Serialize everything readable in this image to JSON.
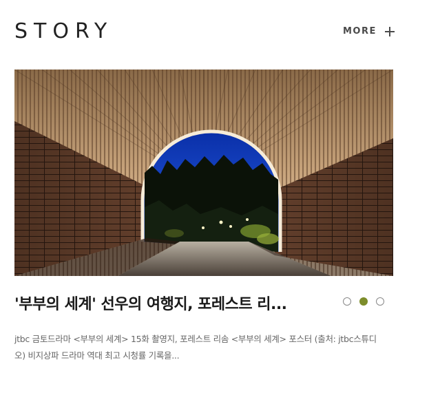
{
  "section": {
    "title": "STORY",
    "more_label": "MORE"
  },
  "hero": {
    "alt": "Forest tunnel with wooden slat arch at night"
  },
  "article": {
    "headline": "'부부의 세계' 선우의 여행지, 포레스트 리...",
    "excerpt": "jtbc 금토드라마 <부부의 세계> 15화 촬영지, 포레스트 리솜 <부부의 세계> 포스터 (출처: jtbc스튜디오) 비지상파 드라마 역대 최고 시청률 기록을..."
  },
  "carousel": {
    "active_index": 1,
    "count": 3,
    "active_color": "#7d8d2b"
  }
}
